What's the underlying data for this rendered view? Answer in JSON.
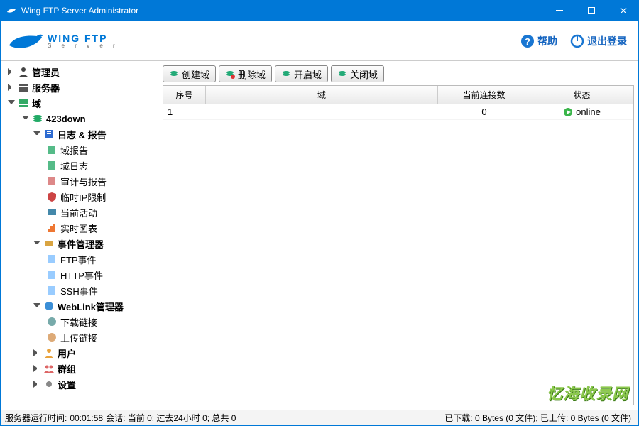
{
  "window": {
    "title": "Wing FTP Server Administrator"
  },
  "header": {
    "logo_line1": "WING FTP",
    "logo_line2": "S e r v e r",
    "help": "帮助",
    "logout": "退出登录"
  },
  "sidebar": {
    "admin": "管理员",
    "server": "服务器",
    "domain_label": "域",
    "domain_name": "423down",
    "log_report": "日志 & 报告",
    "log_items": {
      "domain_report": "域报告",
      "domain_log": "域日志",
      "audit_report": "审计与报告",
      "ip_limit": "临时IP限制",
      "current_activity": "当前活动",
      "realtime_chart": "实时图表"
    },
    "event_manager": "事件管理器",
    "event_items": {
      "ftp": "FTP事件",
      "http": "HTTP事件",
      "ssh": "SSH事件"
    },
    "weblink": "WebLink管理器",
    "weblink_items": {
      "download": "下载链接",
      "upload": "上传链接"
    },
    "users": "用户",
    "groups": "群组",
    "settings": "设置"
  },
  "toolbar": {
    "create": "创建域",
    "delete": "删除域",
    "start": "开启域",
    "stop": "关闭域"
  },
  "table": {
    "columns": {
      "seq": "序号",
      "domain": "域",
      "connections": "当前连接数",
      "status": "状态"
    },
    "rows": [
      {
        "seq": "1",
        "domain": "",
        "connections": "0",
        "status": "online"
      }
    ]
  },
  "status": {
    "uptime_label": "服务器运行时间:",
    "uptime_value": "00:01:58",
    "sessions": "会话: 当前 0;  过去24小时 0;  总共 0",
    "transfer": "已下载: 0 Bytes (0 文件);  已上传: 0 Bytes (0 文件)"
  },
  "watermark": "忆海收录网"
}
